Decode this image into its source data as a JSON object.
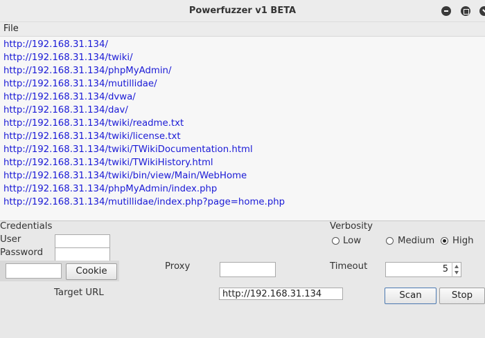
{
  "window": {
    "title": "Powerfuzzer v1 BETA"
  },
  "menu": {
    "file": "File"
  },
  "results": [
    "http://192.168.31.134/",
    "http://192.168.31.134/twiki/",
    "http://192.168.31.134/phpMyAdmin/",
    "http://192.168.31.134/mutillidae/",
    "http://192.168.31.134/dvwa/",
    "http://192.168.31.134/dav/",
    "http://192.168.31.134/twiki/readme.txt",
    "http://192.168.31.134/twiki/license.txt",
    "http://192.168.31.134/twiki/TWikiDocumentation.html",
    "http://192.168.31.134/twiki/TWikiHistory.html",
    "http://192.168.31.134/twiki/bin/view/Main/WebHome",
    "http://192.168.31.134/phpMyAdmin/index.php",
    "http://192.168.31.134/mutillidae/index.php?page=home.php"
  ],
  "credentials": {
    "title": "Credentials",
    "user_label": "User",
    "password_label": "Password",
    "user_value": "",
    "password_value": ""
  },
  "cookie": {
    "value": "",
    "button": "Cookie"
  },
  "proxy": {
    "label": "Proxy",
    "value": ""
  },
  "target": {
    "label": "Target URL",
    "value": "http://192.168.31.134"
  },
  "verbosity": {
    "label": "Verbosity",
    "options": [
      "Low",
      "Medium",
      "High"
    ],
    "selected": "High"
  },
  "timeout": {
    "label": "Timeout",
    "value": "5"
  },
  "actions": {
    "scan": "Scan",
    "stop": "Stop"
  }
}
